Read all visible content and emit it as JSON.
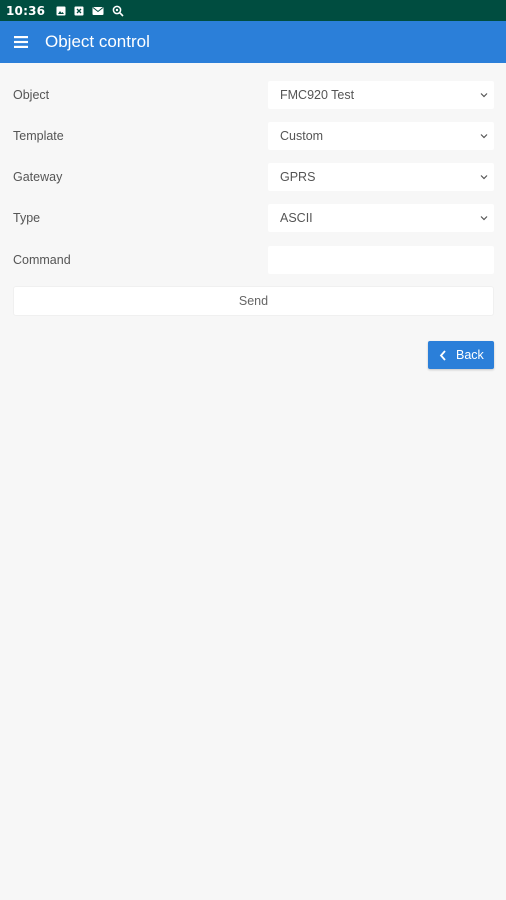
{
  "status_bar": {
    "time": "10:36",
    "background": "#004d40",
    "icons": [
      "image-icon",
      "notification-icon",
      "mail-icon",
      "search-location-icon"
    ]
  },
  "app_bar": {
    "title": "Object control",
    "background": "#2b7fd9",
    "menu_icon": "hamburger-menu-icon"
  },
  "form": {
    "fields": [
      {
        "label": "Object",
        "value": "FMC920 Test",
        "kind": "select"
      },
      {
        "label": "Template",
        "value": "Custom",
        "kind": "select"
      },
      {
        "label": "Gateway",
        "value": "GPRS",
        "kind": "select"
      },
      {
        "label": "Type",
        "value": "ASCII",
        "kind": "select"
      },
      {
        "label": "Command",
        "value": "",
        "kind": "text"
      }
    ],
    "send_label": "Send"
  },
  "back_button": {
    "label": "Back",
    "icon": "chevron-left-icon",
    "background": "#2b7fd9"
  }
}
